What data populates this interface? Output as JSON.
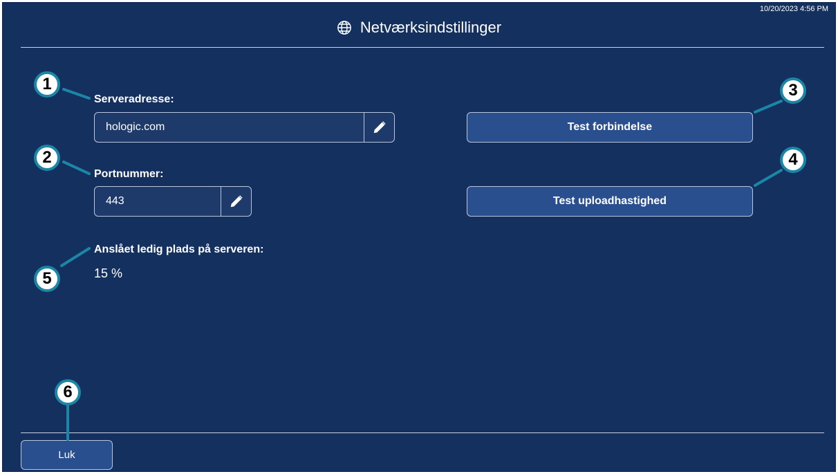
{
  "header": {
    "datetime": "10/20/2023 4:56 PM",
    "title": "Netværksindstillinger",
    "icon": "globe-icon"
  },
  "server": {
    "label": "Serveradresse:",
    "value": "hologic.com",
    "edit_icon": "pencil-icon"
  },
  "port": {
    "label": "Portnummer:",
    "value": "443",
    "edit_icon": "pencil-icon"
  },
  "free_space": {
    "label": "Anslået ledig plads på serveren:",
    "value": "15 %"
  },
  "buttons": {
    "test_connection": "Test forbindelse",
    "test_upload": "Test uploadhastighed",
    "close": "Luk"
  },
  "callouts": [
    "1",
    "2",
    "3",
    "4",
    "5",
    "6"
  ],
  "colors": {
    "background": "#14305f",
    "button": "#2a4f8f",
    "callout_ring": "#1b86a6"
  }
}
